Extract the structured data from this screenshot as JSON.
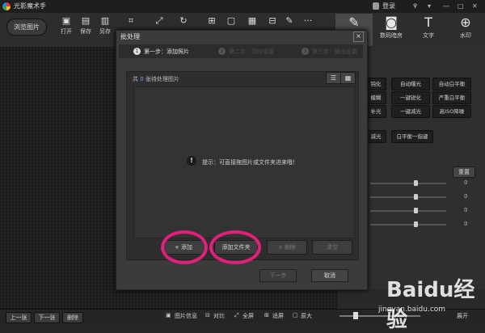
{
  "app": {
    "title": "光影魔术手",
    "login": "登录"
  },
  "toolbar": {
    "browse": "浏览图片",
    "tools": [
      {
        "label": "打开",
        "icon": "open-icon"
      },
      {
        "label": "保存",
        "icon": "save-icon"
      },
      {
        "label": "另存",
        "icon": "save-as-icon"
      },
      {
        "label": "",
        "icon": "crop-icon"
      },
      {
        "label": "",
        "icon": "resize-icon"
      },
      {
        "label": "",
        "icon": "rotate-icon"
      },
      {
        "label": "",
        "icon": "add-icon"
      },
      {
        "label": "",
        "icon": "frame-icon"
      },
      {
        "label": "",
        "icon": "calendar-icon"
      },
      {
        "label": "",
        "icon": "stamp-icon"
      },
      {
        "label": "",
        "icon": "brush-icon"
      },
      {
        "label": "···",
        "icon": "more-icon"
      }
    ],
    "tabs": [
      {
        "label": "",
        "icon": "edit-icon"
      },
      {
        "label": "数码暗房",
        "icon": "camera-icon"
      },
      {
        "label": "文字",
        "icon": "text-icon"
      },
      {
        "label": "水印",
        "icon": "watermark-icon"
      }
    ]
  },
  "right_panel": {
    "buttons": [
      "钝化",
      "自动曝光",
      "自动白平衡",
      "模糊",
      "一键锐化",
      "严重白平衡",
      "补光",
      "一键减光",
      "高ISO降噪",
      "减光",
      "白平衡一指键"
    ],
    "reset": "重置",
    "slider_values": [
      "0",
      "0",
      "0",
      "0"
    ]
  },
  "dialog": {
    "title": "批处理",
    "close": "×",
    "steps": [
      {
        "num": "1",
        "label": "第一步：添加照片",
        "active": true
      },
      {
        "num": "2",
        "label": "第二步：动作设置",
        "active": false
      },
      {
        "num": "3",
        "label": "第三步：输出设置",
        "active": false
      }
    ],
    "count_prefix": "共",
    "count": "0",
    "count_suffix": "张待处理图片",
    "hint": "提示：可直接拖图片或文件夹进来哦！",
    "buttons": {
      "add": "+ 添加",
      "add_folder": "添加文件夹",
      "remove": "× 删除",
      "clear": "清空"
    },
    "next": "下一步",
    "cancel": "取消"
  },
  "statusbar": {
    "prev": "上一张",
    "next": "下一张",
    "delete": "删除",
    "info": "图片信息",
    "compare": "对比",
    "fullscreen": "全屏",
    "fit": "适屏",
    "original": "原大",
    "expand": "展开"
  },
  "watermark": {
    "text": "Baidu经验",
    "url": "jingyan.baidu.com"
  },
  "colors": {
    "highlight_ring": "#e21f7a",
    "accent_blue": "#6fa8ff"
  }
}
